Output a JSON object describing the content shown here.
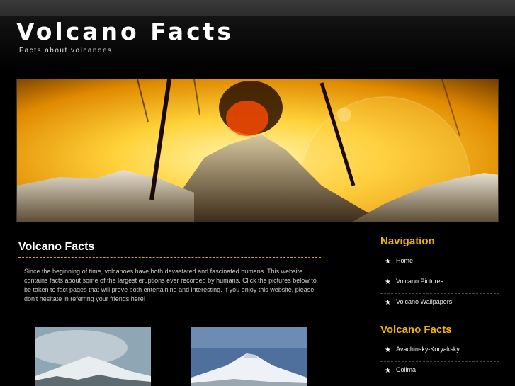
{
  "header": {
    "title": "Volcano Facts",
    "tagline": "Facts about volcanoes"
  },
  "main": {
    "title": "Volcano Facts",
    "intro": "Since the beginning of time, volcanoes have both devastated and fascinated humans. This website contains facts about some of the largest eruptions ever recorded by humans. Click the pictures below to be taken to fact pages that will prove both entertaining and interesting. If you enjoy this website, please don't hesitate in referring your friends here!"
  },
  "sidebar": {
    "navigation_heading": "Navigation",
    "navigation": [
      "Home",
      "Volcano Pictures",
      "Volcano Wallpapers"
    ],
    "facts_heading": "Volcano Facts",
    "facts": [
      "Avachinsky-Koryaksky",
      "Colima"
    ]
  },
  "icons": {
    "list_bullet": "star-icon"
  },
  "colors": {
    "accent": "#f0b400",
    "divider": "#d9a400",
    "background": "#000000"
  }
}
